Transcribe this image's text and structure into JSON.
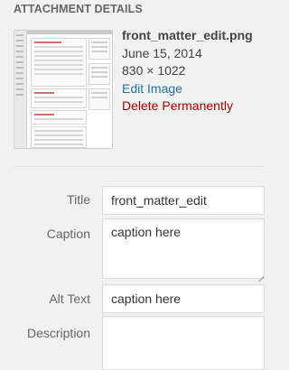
{
  "section_heading": "ATTACHMENT DETAILS",
  "attachment": {
    "filename": "front_matter_edit.png",
    "date": "June 15, 2014",
    "dimensions": "830 × 1022",
    "edit_link": "Edit Image",
    "delete_link": "Delete Permanently"
  },
  "colors": {
    "edit_link": "#21759b",
    "delete_link": "#aa0000"
  },
  "fields": {
    "title": {
      "label": "Title",
      "value": "front_matter_edit"
    },
    "caption": {
      "label": "Caption",
      "value": "caption here"
    },
    "alt_text": {
      "label": "Alt Text",
      "value": "caption here"
    },
    "description": {
      "label": "Description",
      "value": ""
    }
  }
}
